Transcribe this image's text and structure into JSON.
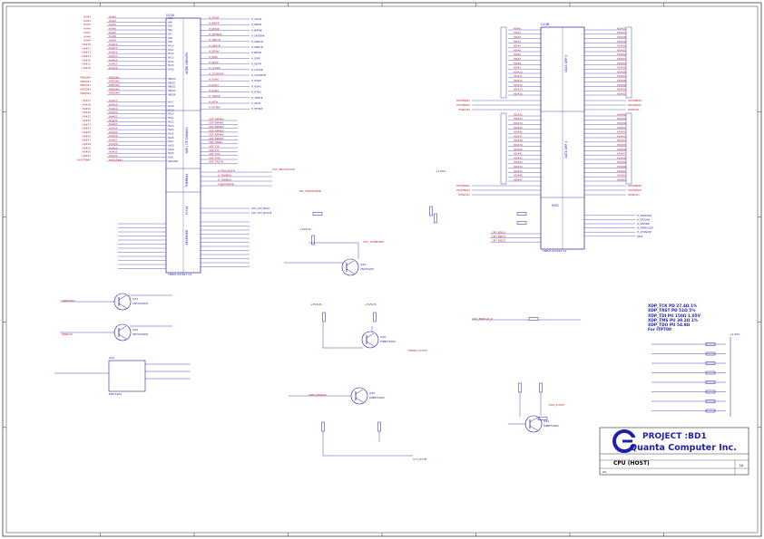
{
  "title_block": {
    "project": "PROJECT :BD1",
    "company": "Quanta Computer Inc.",
    "title": "CPU (HOST)",
    "size": "A3",
    "rev": "1A",
    "sheet_no": "03"
  },
  "chips": {
    "u1a": {
      "ref": "U23A",
      "part": "TMEM-437647-01",
      "groups": [
        "ADDR GROUP0",
        "ADDR GROUP1",
        "CONTROL",
        "XDP / ITP SIGNALS",
        "THERMAL",
        "H CLK",
        "RESERVED"
      ]
    },
    "u1b": {
      "ref": "U23B",
      "part": "TMEM-437647-01",
      "groups": [
        "DATA GRP 0",
        "DATA GRP 1",
        "DATA GRP 2",
        "DATA GRP 3",
        "MISC"
      ]
    },
    "q_prochot": {
      "ref": "Q29",
      "part": "2N7002W"
    },
    "q_forcepr": {
      "ref": "Q30",
      "part": "MMBT3904"
    },
    "q_thrm": {
      "ref": "Q31",
      "part": "MMBT3904"
    },
    "q_fan": {
      "ref": "Q33",
      "part": "MMBT3904"
    },
    "q_pwrgd": {
      "ref": "Q35",
      "part": "MMBT3904"
    },
    "q_smb": [
      {
        "ref": "Q21",
        "part": "2N7002DW"
      },
      {
        "ref": "Q22",
        "part": "2N7002DW"
      }
    ],
    "thermal_sensor": {
      "ref": "U24",
      "part": "EMC1402"
    }
  },
  "left_nets": [
    "HA#3",
    "HA#4",
    "HA#5",
    "HA#6",
    "HA#7",
    "HA#8",
    "HA#9",
    "HA#10",
    "HA#11",
    "HA#12",
    "HA#13",
    "HA#14",
    "HA#15",
    "HA#16",
    "HREQ#0",
    "HREQ#1",
    "HREQ#2",
    "HREQ#3",
    "HREQ#4",
    "HA#17",
    "HA#18",
    "HA#19",
    "HA#20",
    "HA#21",
    "HA#22",
    "HA#23",
    "HA#24",
    "HA#25",
    "HA#26",
    "HA#27",
    "HA#28",
    "HA#29",
    "HA#30",
    "HA#31",
    "HADSTB#1"
  ],
  "right_ctrl_nets": [
    "H_ADS#",
    "H_BNR#",
    "H_BPRI#",
    "H_DEFER#",
    "H_DRDY#",
    "H_DBSY#",
    "H_BR0#",
    "H_IERR",
    "H_INIT#",
    "H_LOCK#",
    "H_CPURST#",
    "H_RS#0",
    "H_RS#1",
    "H_RS#2",
    "H_TRDY#",
    "H_HIT#",
    "H_HITM#"
  ],
  "xdp_nets": [
    "XDP_BPM#0",
    "XDP_BPM#1",
    "XDP_BPM#2",
    "XDP_BPM#3",
    "XDP_BPM#4",
    "XDP_BPM#5",
    "XDP_DBR#",
    "XDP_TCK",
    "XDP_TDI",
    "XDP_TDO",
    "XDP_TMS",
    "XDP_TRST#"
  ],
  "thermal_nets": [
    "H_PROCHOT#",
    "H_THRMDA",
    "H_THRMDC",
    "THERMTRIP#"
  ],
  "clk_nets": [
    "CLK_CPU_BCLK",
    "CLK_CPU_BCLK#"
  ],
  "data_nets_0": [
    "HD#0",
    "HD#1",
    "HD#2",
    "HD#3",
    "HD#4",
    "HD#5",
    "HD#6",
    "HD#7",
    "HD#8",
    "HD#9",
    "HD#10",
    "HD#11",
    "HD#12",
    "HD#13",
    "HD#14",
    "HD#15"
  ],
  "data_nets_1": [
    "HD#16",
    "HD#17",
    "HD#18",
    "HD#19",
    "HD#20",
    "HD#21",
    "HD#22",
    "HD#23",
    "HD#24",
    "HD#25",
    "HD#26",
    "HD#27",
    "HD#28",
    "HD#29",
    "HD#30",
    "HD#31"
  ],
  "data_nets_2": [
    "HD#32",
    "HD#33",
    "HD#34",
    "HD#35",
    "HD#36",
    "HD#37",
    "HD#38",
    "HD#39",
    "HD#40",
    "HD#41",
    "HD#42",
    "HD#43",
    "HD#44",
    "HD#45",
    "HD#46",
    "HD#47"
  ],
  "data_nets_3": [
    "HD#48",
    "HD#49",
    "HD#50",
    "HD#51",
    "HD#52",
    "HD#53",
    "HD#54",
    "HD#55",
    "HD#56",
    "HD#57",
    "HD#58",
    "HD#59",
    "HD#60",
    "HD#61",
    "HD#62",
    "HD#63"
  ],
  "strobe_nets": [
    "HDSTBN#0",
    "HDSTBP#0",
    "HDINV#0",
    "HDSTBN#1",
    "HDSTBP#1",
    "HDINV#1",
    "HDSTBN#2",
    "HDSTBP#2",
    "HDINV#2",
    "HDSTBN#3",
    "HDSTBP#3",
    "HDINV#3"
  ],
  "misc_nets": [
    "CPU_BSEL0",
    "CPU_BSEL1",
    "CPU_BSEL2",
    "H_DPRSTP#",
    "H_DPSLP#",
    "H_DPWR#",
    "H_PWRGOOD",
    "H_CPUSLP#",
    "PSI#"
  ],
  "labels": {
    "cpu_pwrgd": "CPU_PWRGD_R",
    "cpu_prochot": "CPU_PROCHOT#",
    "cpu_thrmtrip": "CPU_THRMTRIP",
    "therm_sys": "THERM_SYSTE",
    "sys_rstb": "SYS_RSTB",
    "smb_data": "SMBDATA",
    "smb_clk": "SMBCLK",
    "pm_thrmtrip": "PM_THRMTRIP#",
    "fan_sys": "FAN_SYSTE",
    "vrm_pwrgd": "VRM_PWRGD",
    "rail_105": "+1.05V",
    "rail_3v": "+3VSUS",
    "rail_5v": "+5VSUS"
  },
  "notes": [
    "XDP_TCK PD 27.4Ω 1%",
    "XDP_TRST PD 51Ω 5%",
    "XDP_TDI PU 150Ω 1.05V",
    "XDP_TMS PU 39.2Ω 1%",
    "XDP_TDO PU 54.9Ω",
    "For ITP700"
  ],
  "colors": {
    "net": "#c8202a",
    "wire": "#1f1fa8",
    "chip": "#1f1fa8",
    "border": "#000000",
    "logo": "#1f1fa8"
  }
}
